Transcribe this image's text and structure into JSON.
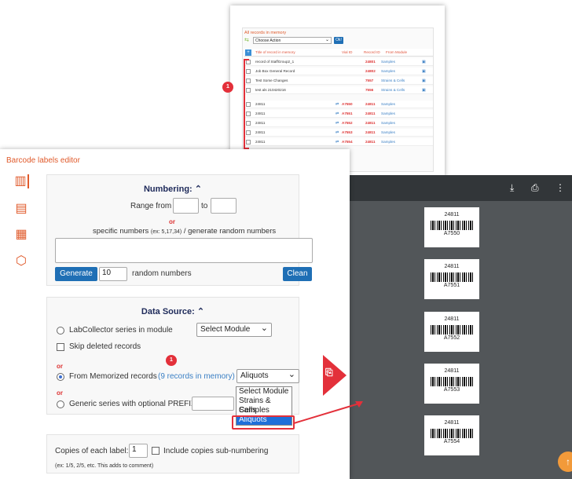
{
  "memory_panel": {
    "title": "All records in memory",
    "action_placeholder": "Choose Action",
    "ok_label": "Ok!",
    "columns": {
      "title": "Title of record in memory",
      "vial": "Vial ID",
      "record": "Record ID",
      "module": "From Module"
    },
    "rows": [
      {
        "title": "record of StaffGroup2_1",
        "vial": "",
        "record": "24801",
        "module": "Samples"
      },
      {
        "title": "Job Box General Record",
        "vial": "",
        "record": "24802",
        "module": "Samples"
      },
      {
        "title": "Test Some Changes",
        "vial": "",
        "record": "7557",
        "module": "Strains & Cells"
      },
      {
        "title": "test als 210420216",
        "vial": "",
        "record": "7556",
        "module": "Strains & Cells"
      },
      {
        "title": "24811",
        "vial": "A7550",
        "record": "24811",
        "module": "Samples"
      },
      {
        "title": "24811",
        "vial": "A7551",
        "record": "24811",
        "module": "Samples"
      },
      {
        "title": "24811",
        "vial": "A7552",
        "record": "24811",
        "module": "Samples"
      },
      {
        "title": "24811",
        "vial": "A7553",
        "record": "24811",
        "module": "Samples"
      },
      {
        "title": "24811",
        "vial": "A7554",
        "record": "24811",
        "module": "Samples"
      }
    ],
    "badge": "1"
  },
  "editor": {
    "title": "Barcode labels editor",
    "numbering": {
      "heading": "Numbering:",
      "range_from": "Range from",
      "to": "to",
      "or": "or",
      "specific_pre": "specific numbers",
      "specific_hint": "(ex: 5,17,34)",
      "specific_post": "/ generate random numbers",
      "generate_label": "Generate",
      "random_count": "10",
      "random_suffix": "random numbers",
      "clean_label": "Clean"
    },
    "data_source": {
      "heading": "Data Source:",
      "opt1_label": "LabCollector series in module",
      "module_select": "Select Module",
      "skip_label": "Skip deleted records",
      "or1": "or",
      "opt2_label": "From Memorized records",
      "memory_link": "(9 records in memory)",
      "memory_select": "Aliquots",
      "or2": "or",
      "opt3_label": "Generic series with optional PREFIX",
      "dropdown": [
        "Select Module",
        "Strains & Cells",
        "Samples",
        "Aliquots"
      ],
      "badge": "1"
    },
    "copies": {
      "label": "Copies of each label:",
      "value": "1",
      "include_label": "Include copies sub-numbering",
      "hint": "(ex: 1/5, 2/5, etc. This adds to comment)"
    }
  },
  "viewer": {
    "labels": [
      {
        "number": "24811",
        "code": "A7550"
      },
      {
        "number": "24811",
        "code": "A7551"
      },
      {
        "number": "24811",
        "code": "A7552"
      },
      {
        "number": "24811",
        "code": "A7553"
      },
      {
        "number": "24811",
        "code": "A7554"
      }
    ]
  }
}
